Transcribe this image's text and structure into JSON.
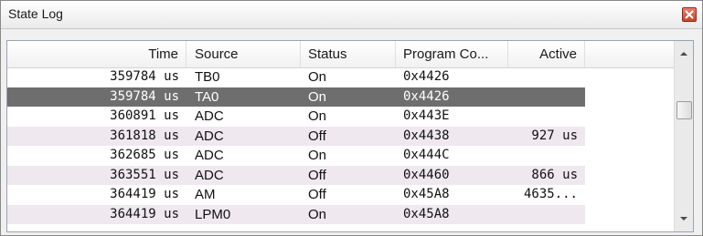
{
  "window": {
    "title": "State Log"
  },
  "columns": {
    "time": "Time",
    "source": "Source",
    "status": "Status",
    "program_counter": "Program Co...",
    "active": "Active"
  },
  "rows": [
    {
      "time": "359784 us",
      "source": "TB0",
      "status": "On",
      "pc": "0x4426",
      "active": ""
    },
    {
      "time": "359784 us",
      "source": "TA0",
      "status": "On",
      "pc": "0x4426",
      "active": ""
    },
    {
      "time": "360891 us",
      "source": "ADC",
      "status": "On",
      "pc": "0x443E",
      "active": ""
    },
    {
      "time": "361818 us",
      "source": "ADC",
      "status": "Off",
      "pc": "0x4438",
      "active": "927 us"
    },
    {
      "time": "362685 us",
      "source": "ADC",
      "status": "On",
      "pc": "0x444C",
      "active": ""
    },
    {
      "time": "363551 us",
      "source": "ADC",
      "status": "Off",
      "pc": "0x4460",
      "active": "866 us"
    },
    {
      "time": "364419 us",
      "source": "AM",
      "status": "Off",
      "pc": "0x45A8",
      "active": "4635..."
    },
    {
      "time": "364419 us",
      "source": "LPM0",
      "status": "On",
      "pc": "0x45A8",
      "active": ""
    }
  ],
  "selected_row_index": 1,
  "icons": {
    "close": "close-icon",
    "scroll_up": "arrow-up-icon",
    "scroll_down": "arrow-down-icon"
  },
  "colors": {
    "selected_row": "#6e6e6e",
    "alt_row": "#efe8ef",
    "close_button": "#c7432e"
  }
}
